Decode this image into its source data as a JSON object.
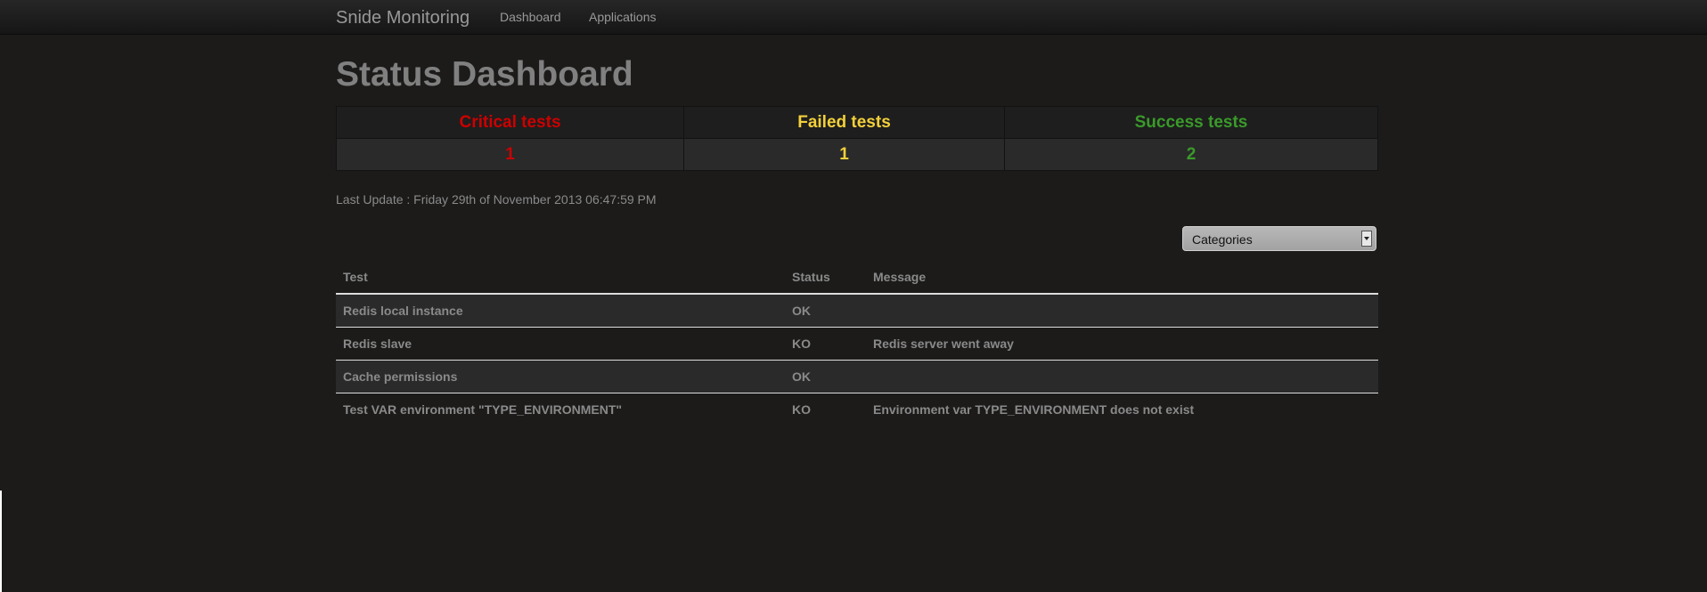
{
  "navbar": {
    "brand": "Snide Monitoring",
    "links": [
      "Dashboard",
      "Applications"
    ]
  },
  "page": {
    "title": "Status Dashboard"
  },
  "summary": {
    "critical": {
      "label": "Critical tests",
      "count": "1",
      "color": "#cc0000"
    },
    "failed": {
      "label": "Failed tests",
      "count": "1",
      "color": "#f3d03a"
    },
    "success": {
      "label": "Success tests",
      "count": "2",
      "color": "#3a9a2a"
    }
  },
  "last_update": "Last Update : Friday 29th of November 2013 06:47:59 PM",
  "categories_select": {
    "selected": "Categories"
  },
  "tests_table": {
    "headers": [
      "Test",
      "Status",
      "Message"
    ],
    "rows": [
      {
        "test": "Redis local instance",
        "status": "OK",
        "message": "",
        "level": "success"
      },
      {
        "test": "Redis slave",
        "status": "KO",
        "message": "Redis server went away",
        "level": "critical"
      },
      {
        "test": "Cache permissions",
        "status": "OK",
        "message": "",
        "level": "success"
      },
      {
        "test": "Test VAR environment \"TYPE_ENVIRONMENT\"",
        "status": "KO",
        "message": "Environment var TYPE_ENVIRONMENT does not exist",
        "level": "failed"
      }
    ]
  },
  "colors": {
    "background": "#1c1b1a",
    "critical": "#cc0000",
    "failed": "#f3d03a",
    "success": "#3a9a2a",
    "muted_text": "#8a8a8a"
  }
}
